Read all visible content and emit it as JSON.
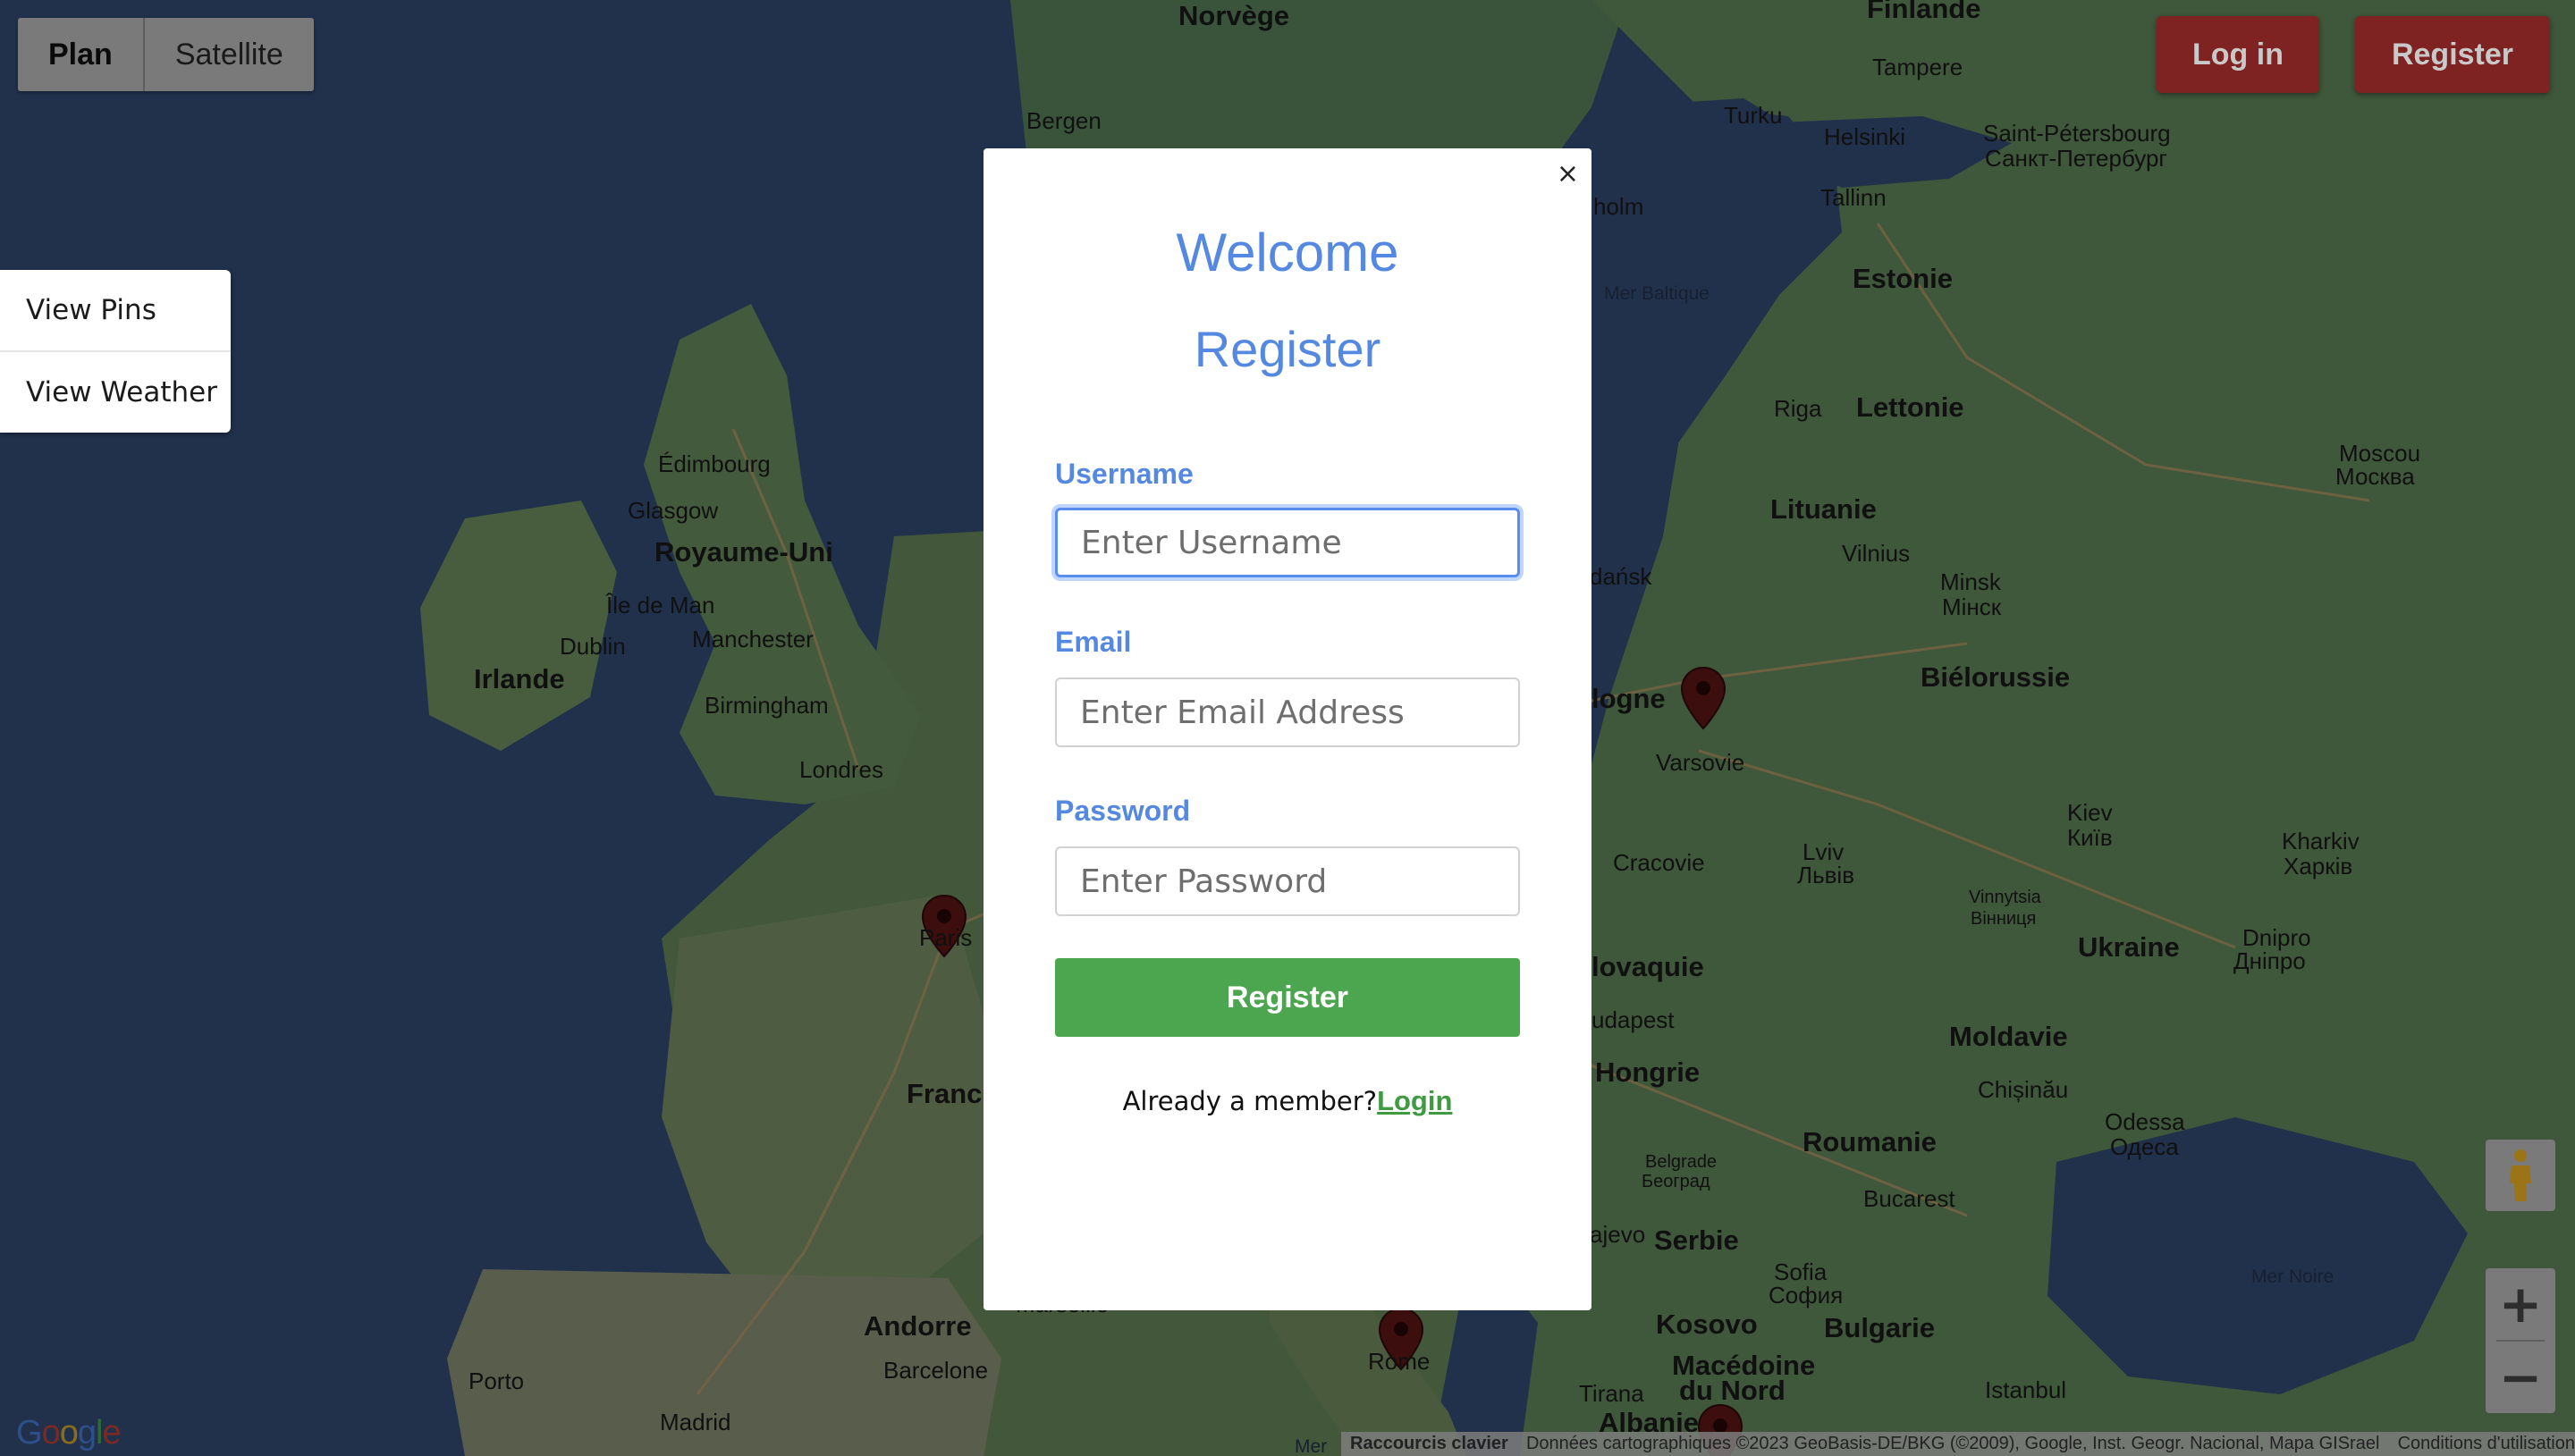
{
  "map": {
    "labels": [
      {
        "text": "Norvège",
        "kind": "country"
      },
      {
        "text": "Finlande",
        "kind": "country"
      },
      {
        "text": "Bergen",
        "kind": "city"
      },
      {
        "text": "Tampere",
        "kind": "city"
      },
      {
        "text": "Turku",
        "kind": "city"
      },
      {
        "text": "Helsinki",
        "kind": "city"
      },
      {
        "text": "Saint-Pétersbourg",
        "kind": "city"
      },
      {
        "text": "Санкт-Петербург",
        "kind": "city"
      },
      {
        "text": "Tallinn",
        "kind": "city"
      },
      {
        "text": "holm",
        "kind": "city"
      },
      {
        "text": "Estonie",
        "kind": "country"
      },
      {
        "text": "Mer Baltique",
        "kind": "sea"
      },
      {
        "text": "Riga",
        "kind": "city"
      },
      {
        "text": "Lettonie",
        "kind": "country"
      },
      {
        "text": "Moscou",
        "kind": "city"
      },
      {
        "text": "Москва",
        "kind": "city"
      },
      {
        "text": "Lituanie",
        "kind": "country"
      },
      {
        "text": "Vilnius",
        "kind": "city"
      },
      {
        "text": "Minsk",
        "kind": "city"
      },
      {
        "text": "Мінск",
        "kind": "city"
      },
      {
        "text": "dańsk",
        "kind": "city"
      },
      {
        "text": "Biélorussie",
        "kind": "country"
      },
      {
        "text": "logne",
        "kind": "country"
      },
      {
        "text": "Varsovie",
        "kind": "city"
      },
      {
        "text": "Kiev",
        "kind": "city"
      },
      {
        "text": "Київ",
        "kind": "city"
      },
      {
        "text": "Kharkiv",
        "kind": "city"
      },
      {
        "text": "Харків",
        "kind": "city"
      },
      {
        "text": "Cracovie",
        "kind": "city"
      },
      {
        "text": "Lviv",
        "kind": "city"
      },
      {
        "text": "Львів",
        "kind": "city"
      },
      {
        "text": "Vinnytsia",
        "kind": "city"
      },
      {
        "text": "Вінниця",
        "kind": "city"
      },
      {
        "text": "Ukraine",
        "kind": "country"
      },
      {
        "text": "Dnipro",
        "kind": "city"
      },
      {
        "text": "Дніпро",
        "kind": "city"
      },
      {
        "text": "lovaquie",
        "kind": "country"
      },
      {
        "text": "udapest",
        "kind": "city"
      },
      {
        "text": "Moldavie",
        "kind": "country"
      },
      {
        "text": "Hongrie",
        "kind": "country"
      },
      {
        "text": "Chișinău",
        "kind": "city"
      },
      {
        "text": "Odessa",
        "kind": "city"
      },
      {
        "text": "Одеса",
        "kind": "city"
      },
      {
        "text": "Roumanie",
        "kind": "country"
      },
      {
        "text": "Belgrade",
        "kind": "city"
      },
      {
        "text": "Београд",
        "kind": "city"
      },
      {
        "text": "Bucarest",
        "kind": "city"
      },
      {
        "text": "ajevo",
        "kind": "city"
      },
      {
        "text": "Serbie",
        "kind": "country"
      },
      {
        "text": "Sofia",
        "kind": "city"
      },
      {
        "text": "София",
        "kind": "city"
      },
      {
        "text": "Mer Noire",
        "kind": "sea"
      },
      {
        "text": "Kosovo",
        "kind": "country"
      },
      {
        "text": "Bulgarie",
        "kind": "country"
      },
      {
        "text": "Macédoine",
        "kind": "country"
      },
      {
        "text": "du Nord",
        "kind": "country"
      },
      {
        "text": "Tirana",
        "kind": "city"
      },
      {
        "text": "Istanbul",
        "kind": "city"
      },
      {
        "text": "Albanie",
        "kind": "country"
      },
      {
        "text": "Rome",
        "kind": "city"
      },
      {
        "text": "Édimbourg",
        "kind": "city"
      },
      {
        "text": "Glasgow",
        "kind": "city"
      },
      {
        "text": "Royaume-Uni",
        "kind": "country"
      },
      {
        "text": "Île de Man",
        "kind": "city"
      },
      {
        "text": "Dublin",
        "kind": "city"
      },
      {
        "text": "Manchester",
        "kind": "city"
      },
      {
        "text": "Irlande",
        "kind": "country"
      },
      {
        "text": "Birmingham",
        "kind": "city"
      },
      {
        "text": "Londres",
        "kind": "city"
      },
      {
        "text": "Paris",
        "kind": "city"
      },
      {
        "text": "Franc",
        "kind": "country"
      },
      {
        "text": "Marseille",
        "kind": "city"
      },
      {
        "text": "Andorre",
        "kind": "country"
      },
      {
        "text": "Barcelone",
        "kind": "city"
      },
      {
        "text": "Porto",
        "kind": "city"
      },
      {
        "text": "Madrid",
        "kind": "city"
      },
      {
        "text": "Mer",
        "kind": "sea"
      }
    ],
    "pins": [
      "Paris",
      "Varsovie",
      "Rome"
    ]
  },
  "maptype": {
    "plan": "Plan",
    "satellite": "Satellite"
  },
  "sidemenu": {
    "items": [
      {
        "label": "View Pins"
      },
      {
        "label": "View Weather"
      }
    ]
  },
  "auth": {
    "login": "Log in",
    "register": "Register"
  },
  "modal": {
    "close": "×",
    "title": "Welcome",
    "subtitle": "Register",
    "username_label": "Username",
    "username_placeholder": "Enter Username",
    "email_label": "Email",
    "email_placeholder": "Enter Email Address",
    "password_label": "Password",
    "password_placeholder": "Enter Password",
    "submit": "Register",
    "member_text": "Already a member?",
    "login_link": "Login"
  },
  "footer": {
    "logo": "Google",
    "shortcuts": "Raccourcis clavier",
    "data": "Données cartographiques ©2023 GeoBasis-DE/BKG (©2009), Google, Inst. Geogr. Nacional, Mapa GISrael",
    "terms": "Conditions d'utilisation"
  },
  "colors": {
    "accent": "#5588e0",
    "success": "#4ca64f",
    "auth": "#7f2222"
  }
}
